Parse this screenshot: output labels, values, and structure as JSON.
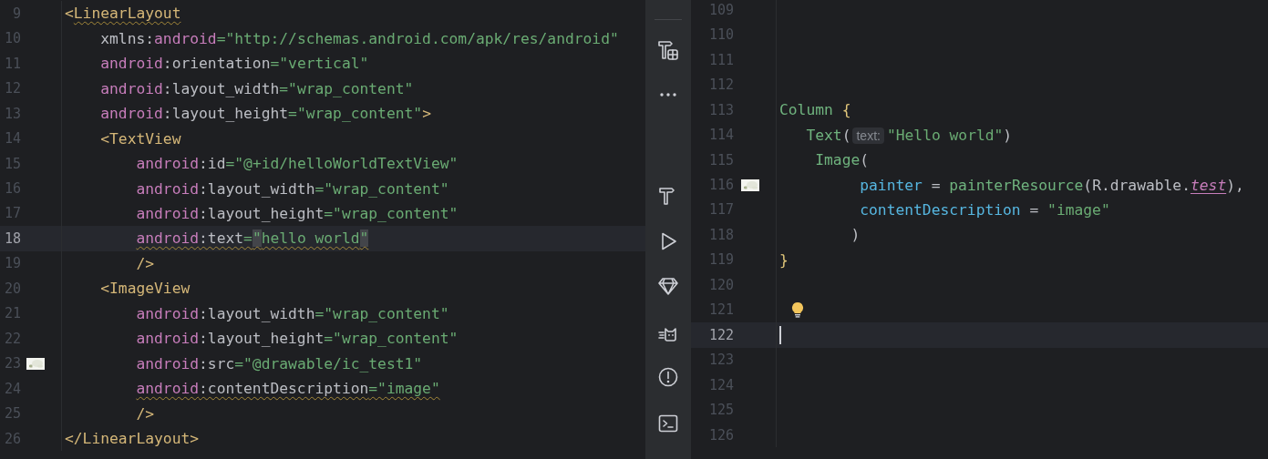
{
  "left_editor": {
    "lines": [
      {
        "number": "9",
        "current": false,
        "kind": "plain",
        "tokens": [
          {
            "kind": "tag",
            "text": "<"
          },
          {
            "kind": "tag",
            "text": "LinearLayout",
            "warn": true
          }
        ]
      },
      {
        "number": "10",
        "current": false,
        "kind": "plain",
        "tokens": [
          {
            "kind": "plain",
            "text": "    xmlns:"
          },
          {
            "kind": "ns",
            "text": "android"
          },
          {
            "kind": "str",
            "text": "=\"http://schemas.android.com/apk/res/android\""
          }
        ]
      },
      {
        "number": "11",
        "current": false,
        "kind": "plain",
        "tokens": [
          {
            "kind": "ns",
            "text": "    android"
          },
          {
            "kind": "plain",
            "text": ":orientation"
          },
          {
            "kind": "str",
            "text": "=\"vertical\""
          }
        ]
      },
      {
        "number": "12",
        "current": false,
        "kind": "plain",
        "tokens": [
          {
            "kind": "ns",
            "text": "    android"
          },
          {
            "kind": "plain",
            "text": ":layout_width"
          },
          {
            "kind": "str",
            "text": "=\"wrap_content\""
          }
        ]
      },
      {
        "number": "13",
        "current": false,
        "kind": "plain",
        "tokens": [
          {
            "kind": "ns",
            "text": "    android"
          },
          {
            "kind": "plain",
            "text": ":layout_height"
          },
          {
            "kind": "str",
            "text": "=\"wrap_content\""
          },
          {
            "kind": "tag",
            "text": ">"
          }
        ]
      },
      {
        "number": "14",
        "current": false,
        "kind": "plain",
        "tokens": [
          {
            "kind": "tag",
            "text": "    <TextView"
          }
        ]
      },
      {
        "number": "15",
        "current": false,
        "kind": "plain",
        "tokens": [
          {
            "kind": "ns",
            "text": "        android"
          },
          {
            "kind": "plain",
            "text": ":id"
          },
          {
            "kind": "str",
            "text": "=\"@+id/helloWorldTextView\""
          }
        ]
      },
      {
        "number": "16",
        "current": false,
        "kind": "plain",
        "tokens": [
          {
            "kind": "ns",
            "text": "        android"
          },
          {
            "kind": "plain",
            "text": ":layout_width"
          },
          {
            "kind": "str",
            "text": "=\"wrap_content\""
          }
        ]
      },
      {
        "number": "17",
        "current": false,
        "kind": "plain",
        "tokens": [
          {
            "kind": "ns",
            "text": "        android"
          },
          {
            "kind": "plain",
            "text": ":layout_height"
          },
          {
            "kind": "str",
            "text": "=\"wrap_content\""
          }
        ]
      },
      {
        "number": "18",
        "current": true,
        "kind": "plain",
        "tokens": [
          {
            "kind": "ns",
            "text": "        android",
            "warn": true
          },
          {
            "kind": "plain",
            "text": ":text",
            "warn": true
          },
          {
            "kind": "str",
            "text": "=",
            "warn": true
          },
          {
            "kind": "str",
            "text": "\"",
            "warn": true,
            "matched": true
          },
          {
            "kind": "str",
            "text": "hello world",
            "warn": true
          },
          {
            "kind": "str",
            "text": "\"",
            "warn": true,
            "matched": true
          }
        ]
      },
      {
        "number": "19",
        "current": false,
        "kind": "plain",
        "tokens": [
          {
            "kind": "tag",
            "text": "        />"
          }
        ]
      },
      {
        "number": "20",
        "current": false,
        "kind": "plain",
        "tokens": [
          {
            "kind": "tag",
            "text": "    <ImageView"
          }
        ]
      },
      {
        "number": "21",
        "current": false,
        "kind": "plain",
        "tokens": [
          {
            "kind": "ns",
            "text": "        android"
          },
          {
            "kind": "plain",
            "text": ":layout_width"
          },
          {
            "kind": "str",
            "text": "=\"wrap_content\""
          }
        ]
      },
      {
        "number": "22",
        "current": false,
        "kind": "plain",
        "tokens": [
          {
            "kind": "ns",
            "text": "        android"
          },
          {
            "kind": "plain",
            "text": ":layout_height"
          },
          {
            "kind": "str",
            "text": "=\"wrap_content\""
          }
        ]
      },
      {
        "number": "23",
        "current": false,
        "kind": "picture",
        "tokens": [
          {
            "kind": "ns",
            "text": "        android"
          },
          {
            "kind": "plain",
            "text": ":src"
          },
          {
            "kind": "str",
            "text": "=\"@drawable/ic_test1\""
          }
        ]
      },
      {
        "number": "24",
        "current": false,
        "kind": "plain",
        "tokens": [
          {
            "kind": "ns",
            "text": "        android",
            "warn": true
          },
          {
            "kind": "plain",
            "text": ":contentDescription",
            "warn": true
          },
          {
            "kind": "str",
            "text": "=\"image\"",
            "warn": true
          }
        ]
      },
      {
        "number": "25",
        "current": false,
        "kind": "plain",
        "tokens": [
          {
            "kind": "tag",
            "text": "        />"
          }
        ]
      },
      {
        "number": "26",
        "current": false,
        "kind": "plain",
        "tokens": [
          {
            "kind": "tag",
            "text": "</LinearLayout>"
          }
        ]
      }
    ]
  },
  "right_editor": {
    "lines": [
      {
        "number": "109",
        "current": false,
        "kind": "plain"
      },
      {
        "number": "110",
        "current": false,
        "kind": "plain"
      },
      {
        "number": "111",
        "current": false,
        "kind": "plain"
      },
      {
        "number": "112",
        "current": false,
        "kind": "plain"
      },
      {
        "number": "113",
        "current": false,
        "kind": "plain",
        "tokens": [
          {
            "kind": "fn",
            "text": "Column"
          },
          {
            "kind": "brace",
            "text": " {"
          }
        ]
      },
      {
        "number": "114",
        "current": false,
        "kind": "plain",
        "tokens": [
          {
            "kind": "fn",
            "text": "   Text"
          },
          {
            "kind": "plain",
            "text": "("
          },
          {
            "kind": "hint",
            "text": "text:"
          },
          {
            "kind": "str",
            "text": "\"Hello world\""
          },
          {
            "kind": "plain",
            "text": ")"
          }
        ]
      },
      {
        "number": "115",
        "current": false,
        "kind": "plain",
        "tokens": [
          {
            "kind": "fn",
            "text": "    Image"
          },
          {
            "kind": "plain",
            "text": "("
          }
        ]
      },
      {
        "number": "116",
        "current": false,
        "kind": "picture",
        "tokens": [
          {
            "kind": "param",
            "text": "         painter"
          },
          {
            "kind": "plain",
            "text": " = "
          },
          {
            "kind": "fn",
            "text": "painterResource"
          },
          {
            "kind": "plain",
            "text": "(R.drawable."
          },
          {
            "kind": "ref",
            "text": "test"
          },
          {
            "kind": "plain",
            "text": "),"
          }
        ]
      },
      {
        "number": "117",
        "current": false,
        "kind": "plain",
        "tokens": [
          {
            "kind": "param",
            "text": "         contentDescription"
          },
          {
            "kind": "plain",
            "text": " = "
          },
          {
            "kind": "str",
            "text": "\"image\""
          }
        ]
      },
      {
        "number": "118",
        "current": false,
        "kind": "plain",
        "tokens": [
          {
            "kind": "plain",
            "text": "        )"
          }
        ]
      },
      {
        "number": "119",
        "current": false,
        "kind": "plain",
        "tokens": [
          {
            "kind": "brace",
            "text": "}"
          }
        ]
      },
      {
        "number": "120",
        "current": false,
        "kind": "plain"
      },
      {
        "number": "121",
        "current": false,
        "kind": "bulb"
      },
      {
        "number": "122",
        "current": true,
        "kind": "plain",
        "caret": true
      },
      {
        "number": "123",
        "current": false,
        "kind": "plain"
      },
      {
        "number": "124",
        "current": false,
        "kind": "plain"
      },
      {
        "number": "125",
        "current": false,
        "kind": "plain"
      },
      {
        "number": "126",
        "current": false,
        "kind": "plain"
      }
    ]
  }
}
